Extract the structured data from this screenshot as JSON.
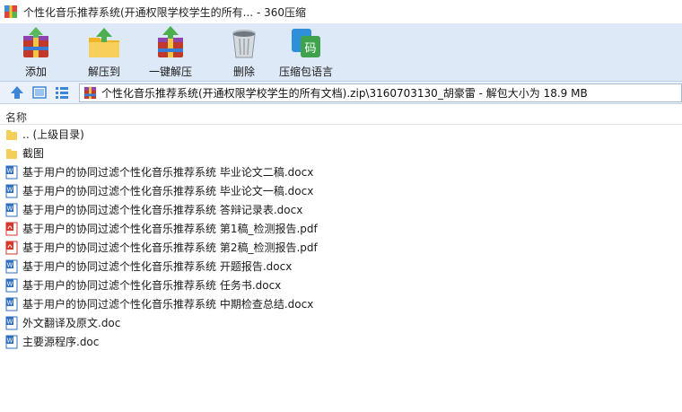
{
  "window": {
    "title": "个性化音乐推荐系统(开通权限学校学生的所有... - 360压缩"
  },
  "toolbar": {
    "add_label": "添加",
    "extract_to_label": "解压到",
    "one_click_extract_label": "一键解压",
    "delete_label": "删除",
    "encoding_label": "压缩包语言"
  },
  "address": {
    "path": "个性化音乐推荐系统(开通权限学校学生的所有文档).zip\\3160703130_胡豪雷 - 解包大小为 18.9 MB"
  },
  "list_header": {
    "name_column": "名称"
  },
  "files": [
    {
      "name": ".. (上级目录)",
      "type": "folder"
    },
    {
      "name": "截图",
      "type": "folder"
    },
    {
      "name": "基于用户的协同过滤个性化音乐推荐系统 毕业论文二稿.docx",
      "type": "word"
    },
    {
      "name": "基于用户的协同过滤个性化音乐推荐系统 毕业论文一稿.docx",
      "type": "word"
    },
    {
      "name": "基于用户的协同过滤个性化音乐推荐系统 答辩记录表.docx",
      "type": "word"
    },
    {
      "name": "基于用户的协同过滤个性化音乐推荐系统 第1稿_检测报告.pdf",
      "type": "pdf"
    },
    {
      "name": "基于用户的协同过滤个性化音乐推荐系统 第2稿_检测报告.pdf",
      "type": "pdf"
    },
    {
      "name": "基于用户的协同过滤个性化音乐推荐系统 开题报告.docx",
      "type": "word"
    },
    {
      "name": "基于用户的协同过滤个性化音乐推荐系统 任务书.docx",
      "type": "word"
    },
    {
      "name": "基于用户的协同过滤个性化音乐推荐系统 中期检查总结.docx",
      "type": "word"
    },
    {
      "name": "外文翻译及原文.doc",
      "type": "word"
    },
    {
      "name": "主要源程序.doc",
      "type": "word"
    }
  ],
  "colors": {
    "toolbar_bg": "#dde9f6",
    "address_bg": "#eaf1fa",
    "folder": "#f3cf5a",
    "word": "#2f6fc0",
    "pdf": "#d9362b"
  }
}
